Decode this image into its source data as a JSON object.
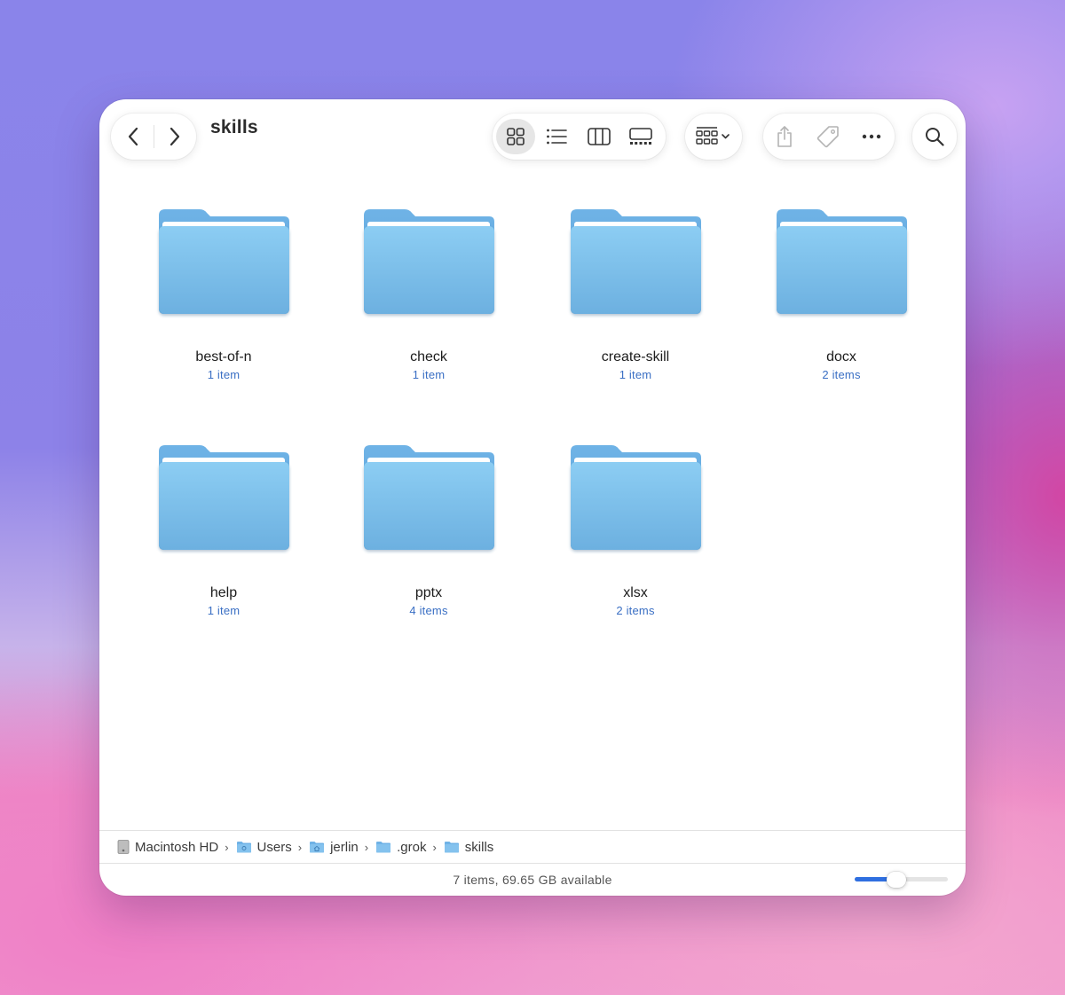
{
  "window": {
    "title": "skills"
  },
  "toolbar": {
    "back_icon": "chevron-left-icon",
    "forward_icon": "chevron-right-icon",
    "view_modes": [
      "icon-view",
      "list-view",
      "column-view",
      "gallery-view"
    ],
    "selected_view": "icon-view",
    "group_icon": "group-by-icon",
    "share_icon": "share-icon",
    "tag_icon": "tag-icon",
    "more_icon": "ellipsis-icon",
    "search_icon": "search-icon"
  },
  "folders": [
    {
      "name": "best-of-n",
      "count": "1 item"
    },
    {
      "name": "check",
      "count": "1 item"
    },
    {
      "name": "create-skill",
      "count": "1 item"
    },
    {
      "name": "docx",
      "count": "2 items"
    },
    {
      "name": "help",
      "count": "1 item"
    },
    {
      "name": "pptx",
      "count": "4 items"
    },
    {
      "name": "xlsx",
      "count": "2 items"
    }
  ],
  "path": [
    {
      "label": "Macintosh HD",
      "icon": "hard-drive-icon"
    },
    {
      "label": "Users",
      "icon": "folder-icon"
    },
    {
      "label": "jerlin",
      "icon": "home-folder-icon"
    },
    {
      "label": ".grok",
      "icon": "folder-icon"
    },
    {
      "label": "skills",
      "icon": "folder-icon"
    }
  ],
  "status": {
    "text": "7 items, 69.65 GB available"
  },
  "icon_size_slider": {
    "value": 0.45
  },
  "colors": {
    "accent": "#2f6fe0",
    "folder": "#7cbde9",
    "count_text": "#3a6fc4"
  }
}
